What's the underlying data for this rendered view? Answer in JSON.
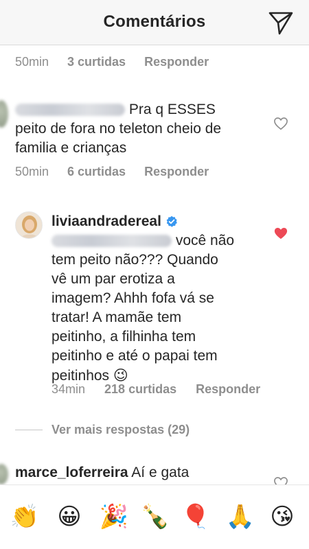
{
  "header": {
    "title": "Comentários",
    "send_icon": "paper-plane-icon"
  },
  "comment_top": {
    "time": "50min",
    "likes": "3 curtidas",
    "reply": "Responder"
  },
  "comment_1": {
    "text_line1": "Pra q ESSES",
    "text_line2": "peito de fora no teleton cheio de",
    "text_line3": "familia e crianças",
    "time": "50min",
    "likes": "6 curtidas",
    "reply": "Responder"
  },
  "comment_2": {
    "username": "liviaandradereal",
    "verified_icon": "verified-badge-icon",
    "lines": [
      "você não",
      "tem peito não??? Quando",
      "vê um par erotiza a",
      "imagem? Ahhh fofa vá se",
      "tratar! A mamãe tem",
      "peitinho, a filhinha tem",
      "peitinho e até o papai tem",
      "peitinhos"
    ],
    "emoji": "😉",
    "time": "34min",
    "likes": "218 curtidas",
    "reply": "Responder",
    "liked_color": "#ed4956"
  },
  "more_replies": "Ver mais respostas (29)",
  "comment_3": {
    "username": "marce_loferreira",
    "text": "Aí e gata"
  },
  "emoji_bar": [
    "👏",
    "😀",
    "🎉",
    "🍾",
    "🎈",
    "🙏",
    "😘"
  ]
}
